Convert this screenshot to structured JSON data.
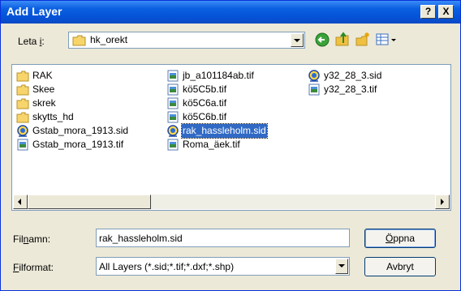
{
  "window": {
    "title": "Add Layer",
    "help_label": "?",
    "close_label": "X"
  },
  "lookin": {
    "label_pre": "Leta ",
    "label_key": "i",
    "label_post": ":",
    "value": "hk_orekt",
    "icon": "folder-icon"
  },
  "toolbar": {
    "back_icon": "back-arrow-icon",
    "up_icon": "up-folder-icon",
    "new_folder_icon": "new-folder-icon",
    "view_icon": "view-menu-icon"
  },
  "files": {
    "col1": [
      {
        "name": "RAK",
        "icon": "folder-icon"
      },
      {
        "name": "Skee",
        "icon": "folder-icon"
      },
      {
        "name": "skrek",
        "icon": "folder-icon"
      },
      {
        "name": "skytts_hd",
        "icon": "folder-icon"
      },
      {
        "name": "Gstab_mora_1913.sid",
        "icon": "sid-file-icon"
      },
      {
        "name": "Gstab_mora_1913.tif",
        "icon": "tif-file-icon"
      }
    ],
    "col2": [
      {
        "name": "jb_a101184ab.tif",
        "icon": "tif-file-icon"
      },
      {
        "name": "kö5C5b.tif",
        "icon": "tif-file-icon"
      },
      {
        "name": "kö5C6a.tif",
        "icon": "tif-file-icon"
      },
      {
        "name": "kö5C6b.tif",
        "icon": "tif-file-icon"
      },
      {
        "name": "rak_hassleholm.sid",
        "icon": "sid-file-icon",
        "selected": true
      },
      {
        "name": "Roma_äek.tif",
        "icon": "tif-file-icon"
      }
    ],
    "col3": [
      {
        "name": "y32_28_3.sid",
        "icon": "sid-file-icon"
      },
      {
        "name": "y32_28_3.tif",
        "icon": "tif-file-icon"
      }
    ]
  },
  "filename": {
    "label_pre": "Fil",
    "label_key": "n",
    "label_post": "amn:",
    "value": "rak_hassleholm.sid"
  },
  "filetype": {
    "label_pre": "",
    "label_key": "F",
    "label_post": "ilformat:",
    "value": "All Layers (*.sid;*.tif;*.dxf;*.shp)"
  },
  "buttons": {
    "open_key": "Ö",
    "open_rest": "ppna",
    "cancel": "Avbryt"
  },
  "colors": {
    "titlebar": "#0a5fe0",
    "selection": "#316ac5",
    "dialog_bg": "#ece9d8"
  }
}
